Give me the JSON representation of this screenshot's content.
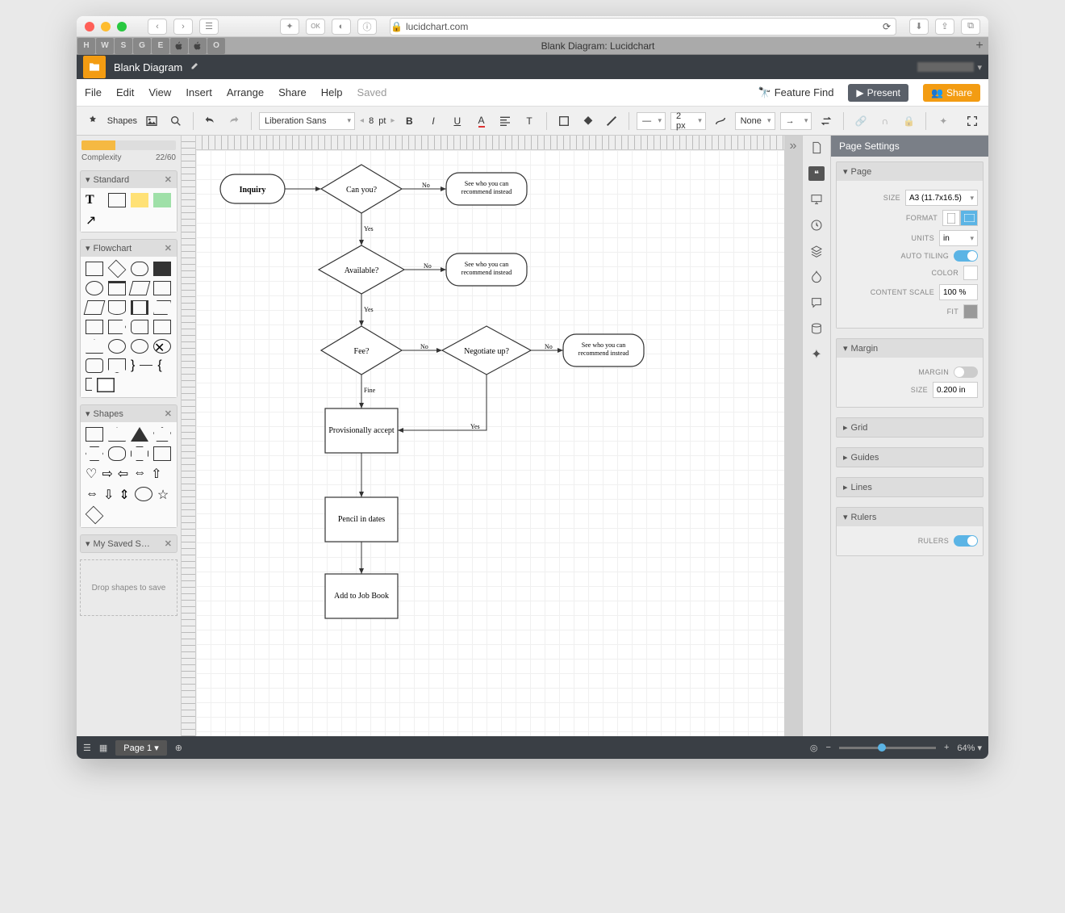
{
  "browser": {
    "url": "lucidchart.com",
    "tab_title": "Blank Diagram: Lucidchart",
    "favs": [
      "H",
      "W",
      "S",
      "G",
      "E"
    ]
  },
  "header": {
    "doc_name": "Blank Diagram",
    "user": ""
  },
  "menu": {
    "items": [
      "File",
      "Edit",
      "View",
      "Insert",
      "Arrange",
      "Share",
      "Help"
    ],
    "status": "Saved",
    "feature": "Feature Find",
    "present": "Present",
    "share": "Share"
  },
  "toolbar": {
    "shapes": "Shapes",
    "font": "Liberation Sans",
    "font_size": "8",
    "unit": "pt",
    "line_style": "None",
    "line_w": "2 px"
  },
  "sidebar": {
    "complexity_label": "Complexity",
    "complexity_val": "22/60",
    "groups": [
      {
        "name": "Standard"
      },
      {
        "name": "Flowchart"
      },
      {
        "name": "Shapes"
      },
      {
        "name": "My Saved S…"
      }
    ],
    "saved_hint": "Drop shapes to save"
  },
  "flow": {
    "nodes": {
      "inquiry": "Inquiry",
      "canyou": "Can you?",
      "rec1": "See who you can\nrecommend instead",
      "available": "Available?",
      "rec2": "See who you can\nrecommend instead",
      "fee": "Fee?",
      "negotiate": "Negotiate up?",
      "rec3": "See who you can\nrecommend instead",
      "accept": "Provisionally accept",
      "pencil": "Pencil in dates",
      "jobbook": "Add to Job Book"
    },
    "edges": {
      "no": "No",
      "yes": "Yes",
      "fine": "Fine"
    }
  },
  "right": {
    "title": "Page Settings",
    "page": {
      "label": "Page",
      "size": "A3 (11.7x16.5)",
      "format": "FORMAT",
      "units_lbl": "UNITS",
      "units": "in",
      "autotile": "AUTO TILING",
      "color": "COLOR",
      "scale_lbl": "CONTENT SCALE",
      "scale": "100 %",
      "fit": "FIT"
    },
    "margin": {
      "label": "Margin",
      "margin_lbl": "MARGIN",
      "size_lbl": "SIZE",
      "size": "0.200 in"
    },
    "grid": "Grid",
    "guides": "Guides",
    "lines": "Lines",
    "rulers": {
      "label": "Rulers",
      "rulers_lbl": "RULERS"
    }
  },
  "status": {
    "page": "Page 1",
    "zoom": "64%"
  }
}
